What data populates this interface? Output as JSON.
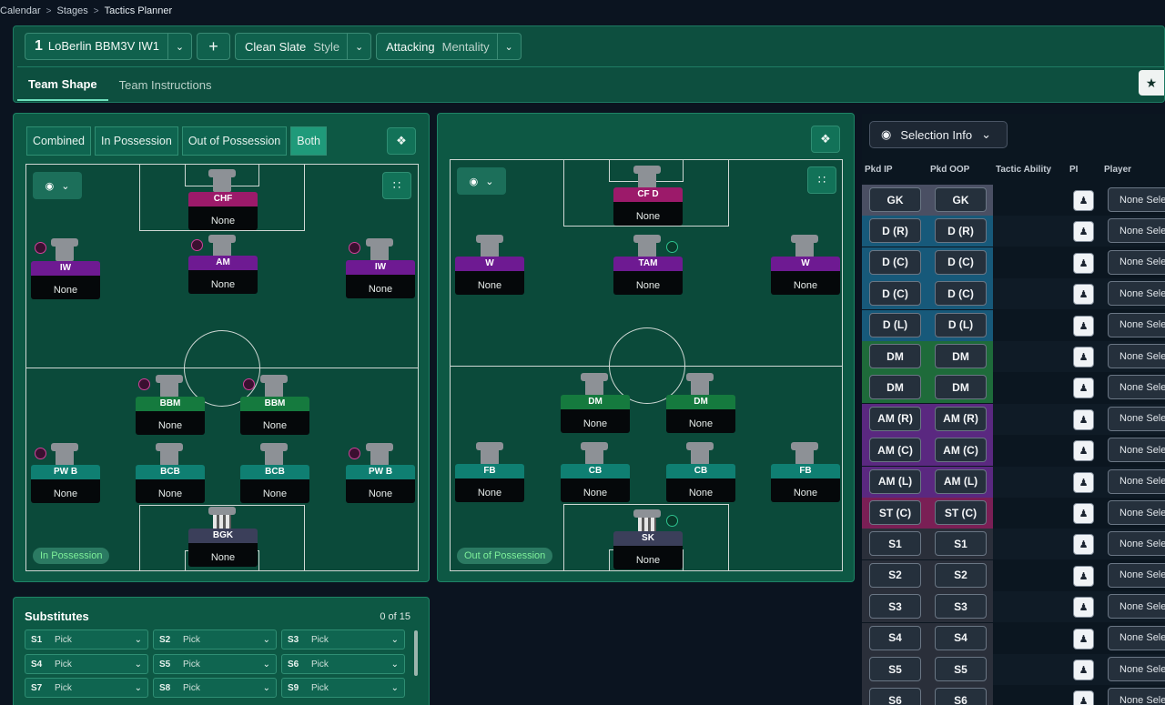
{
  "breadcrumb": [
    "Calendar",
    "Stages",
    "Tactics Planner"
  ],
  "header": {
    "tactic_number": "1",
    "tactic_name": "LoBerlin BBM3V IW1",
    "add_label": "+",
    "style_value": "Clean Slate",
    "style_label": "Style",
    "mentality_value": "Attacking",
    "mentality_label": "Mentality",
    "tabs": [
      "Team Shape",
      "Team Instructions"
    ],
    "active_tab": "Team Shape"
  },
  "view_toggle": [
    "Combined",
    "In Possession",
    "Out of Possession",
    "Both"
  ],
  "active_view": "Both",
  "in_possession": {
    "badge": "In Possession",
    "players": [
      {
        "role": "CHF",
        "name": "None"
      },
      {
        "role": "IW",
        "name": "None"
      },
      {
        "role": "AM",
        "name": "None"
      },
      {
        "role": "IW",
        "name": "None"
      },
      {
        "role": "BBM",
        "name": "None"
      },
      {
        "role": "BBM",
        "name": "None"
      },
      {
        "role": "PW B",
        "name": "None"
      },
      {
        "role": "BCB",
        "name": "None"
      },
      {
        "role": "BCB",
        "name": "None"
      },
      {
        "role": "PW B",
        "name": "None"
      },
      {
        "role": "BGK",
        "name": "None"
      }
    ]
  },
  "out_of_possession": {
    "badge": "Out of Possession",
    "players": [
      {
        "role": "CF D",
        "name": "None"
      },
      {
        "role": "W",
        "name": "None"
      },
      {
        "role": "TAM",
        "name": "None"
      },
      {
        "role": "W",
        "name": "None"
      },
      {
        "role": "DM",
        "name": "None"
      },
      {
        "role": "DM",
        "name": "None"
      },
      {
        "role": "FB",
        "name": "None"
      },
      {
        "role": "CB",
        "name": "None"
      },
      {
        "role": "CB",
        "name": "None"
      },
      {
        "role": "FB",
        "name": "None"
      },
      {
        "role": "SK",
        "name": "None"
      }
    ]
  },
  "substitutes": {
    "title": "Substitutes",
    "count": "0 of 15",
    "slots": [
      {
        "slot": "S1",
        "value": "Pick"
      },
      {
        "slot": "S2",
        "value": "Pick"
      },
      {
        "slot": "S3",
        "value": "Pick"
      },
      {
        "slot": "S4",
        "value": "Pick"
      },
      {
        "slot": "S5",
        "value": "Pick"
      },
      {
        "slot": "S6",
        "value": "Pick"
      },
      {
        "slot": "S7",
        "value": "Pick"
      },
      {
        "slot": "S8",
        "value": "Pick"
      },
      {
        "slot": "S9",
        "value": "Pick"
      }
    ]
  },
  "selection_info": {
    "button_label": "Selection Info",
    "columns": [
      "Pkd IP",
      "Pkd OOP",
      "Tactic Ability",
      "PI",
      "Player"
    ],
    "rows": [
      {
        "ip": "GK",
        "oop": "GK",
        "player": "None Selected"
      },
      {
        "ip": "D (R)",
        "oop": "D (R)",
        "player": "None Selected"
      },
      {
        "ip": "D (C)",
        "oop": "D (C)",
        "player": "None Selected"
      },
      {
        "ip": "D (C)",
        "oop": "D (C)",
        "player": "None Selected"
      },
      {
        "ip": "D (L)",
        "oop": "D (L)",
        "player": "None Selected"
      },
      {
        "ip": "DM",
        "oop": "DM",
        "player": "None Selected"
      },
      {
        "ip": "DM",
        "oop": "DM",
        "player": "None Selected"
      },
      {
        "ip": "AM (R)",
        "oop": "AM (R)",
        "player": "None Selected"
      },
      {
        "ip": "AM (C)",
        "oop": "AM (C)",
        "player": "None Selected"
      },
      {
        "ip": "AM (L)",
        "oop": "AM (L)",
        "player": "None Selected"
      },
      {
        "ip": "ST (C)",
        "oop": "ST (C)",
        "player": "None Selected"
      },
      {
        "ip": "S1",
        "oop": "S1",
        "player": "None Selected"
      },
      {
        "ip": "S2",
        "oop": "S2",
        "player": "None Selected"
      },
      {
        "ip": "S3",
        "oop": "S3",
        "player": "None Selected"
      },
      {
        "ip": "S4",
        "oop": "S4",
        "player": "None Selected"
      },
      {
        "ip": "S5",
        "oop": "S5",
        "player": "None Selected"
      },
      {
        "ip": "S6",
        "oop": "S6",
        "player": "None Selected"
      }
    ]
  },
  "colors": {
    "gk": "#4a4f63",
    "def": "#17597a",
    "dm": "#1e6b3a",
    "am": "#5a2880",
    "st": "#7a1f55",
    "sub": "#2a2f3a"
  }
}
